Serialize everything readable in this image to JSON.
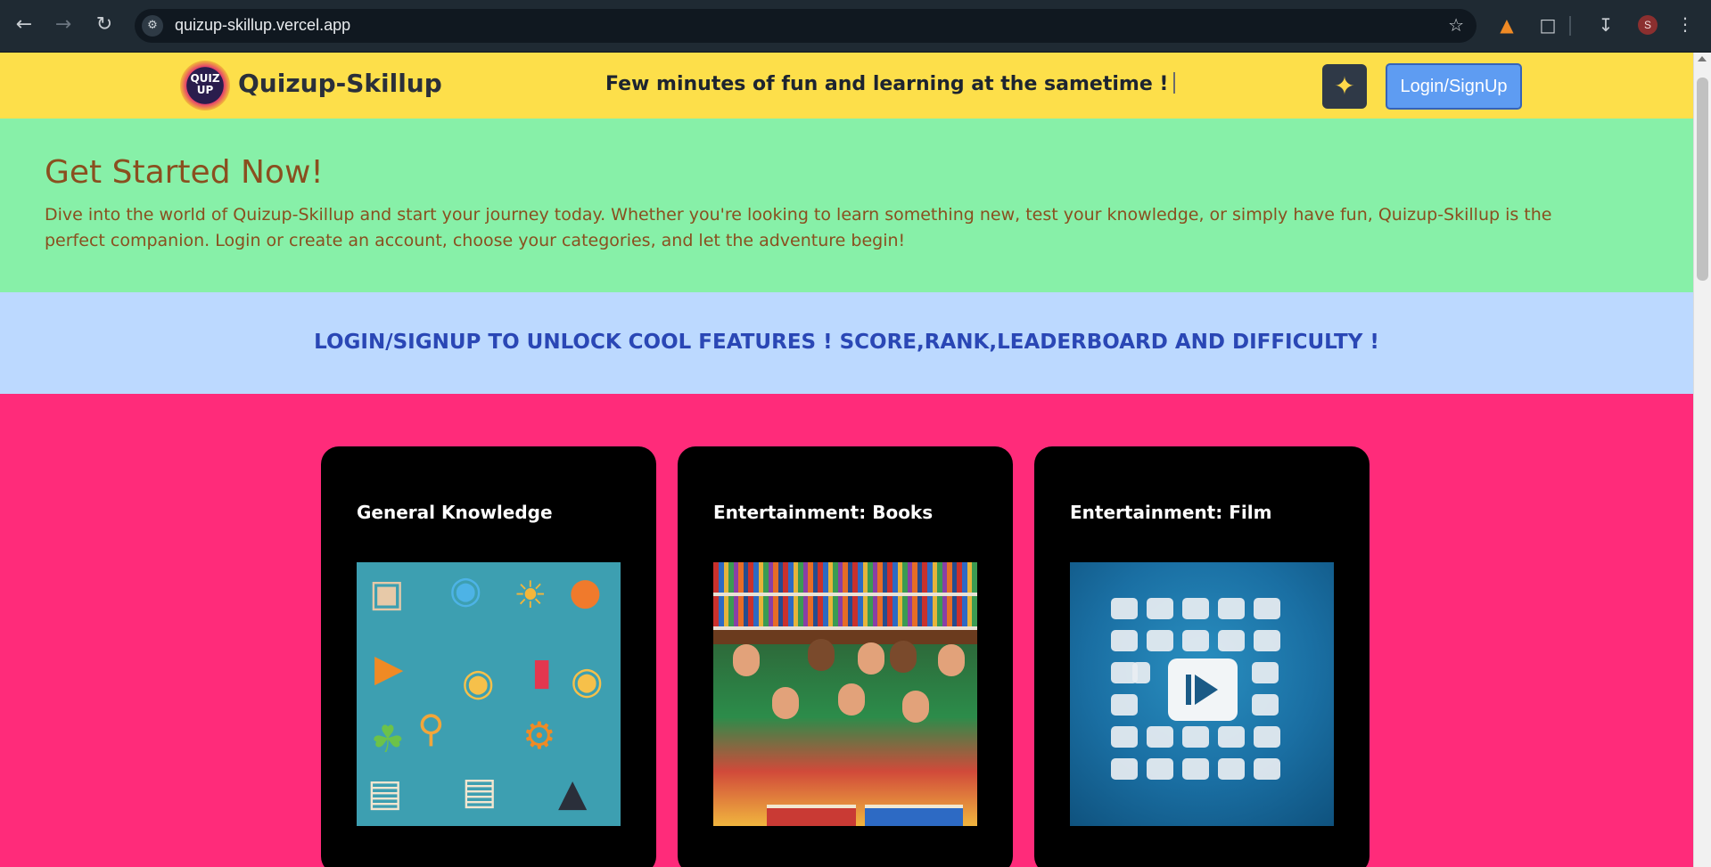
{
  "browser": {
    "url": "quizup-skillup.vercel.app",
    "profile_initial": "S",
    "icons": [
      "back-icon",
      "forward-icon",
      "reload-icon",
      "site-info-icon",
      "bookmark-star-icon",
      "metamask-fox-icon",
      "extensions-puzzle-icon",
      "download-icon",
      "menu-kebab-icon"
    ]
  },
  "header": {
    "logo_text": "QUIZ UP",
    "brand": "Quizup-Skillup",
    "tagline": "Few minutes of fun and learning at the sametime !",
    "theme_icon": "sparkles-icon",
    "login_label": "Login/SignUp"
  },
  "get_started": {
    "title": "Get Started Now!",
    "text": "Dive into the world of Quizup-Skillup and start your journey today. Whether you're looking to learn something new, test your knowledge, or simply have fun, Quizup-Skillup is the perfect companion. Login or create an account, choose your categories, and let the adventure begin!"
  },
  "banner": {
    "text": "LOGIN/SIGNUP TO UNLOCK COOL FEATURES ! SCORE,RANK,LEADERBOARD AND DIFFICULTY !"
  },
  "categories": [
    {
      "title": "General Knowledge"
    },
    {
      "title": "Entertainment: Books"
    },
    {
      "title": "Entertainment: Film"
    }
  ],
  "colors": {
    "header_bg": "#fddf4a",
    "started_bg": "#87f0a8",
    "banner_bg": "#bcd9ff",
    "cards_bg": "#ff2b7a",
    "card_bg": "#000000",
    "login_button": "#5e9cf2"
  }
}
